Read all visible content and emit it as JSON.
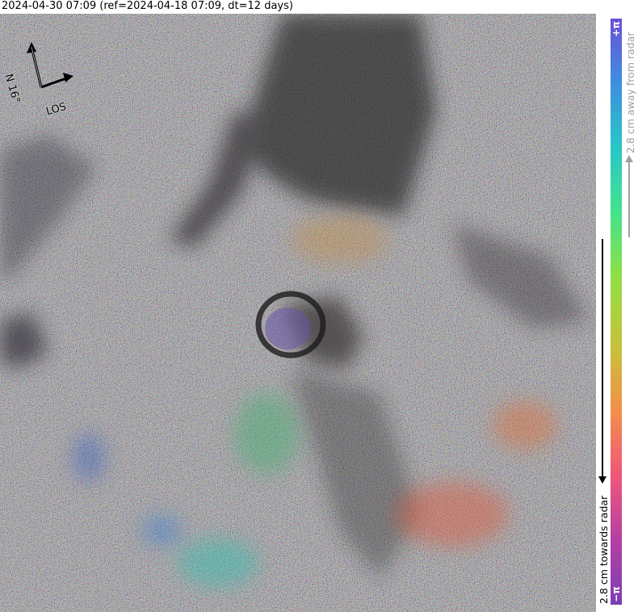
{
  "title": "2024-04-30 07:09 (ref=2024-04-18 07:09, dt=12 days)",
  "compass": {
    "north_label": "N 16°",
    "los_label": "LOS",
    "north_icon": "north-arrow-icon",
    "los_icon": "los-arrow-icon"
  },
  "colorbar": {
    "top_label": "+π",
    "bottom_label": "−π",
    "away_label": "2.8 cm away from radar",
    "toward_label": "2.8 cm towards radar",
    "colors": [
      "#7a3fb4",
      "#b53fa4",
      "#f0567a",
      "#f38f4a",
      "#c7c23a",
      "#8ee044",
      "#43e38e",
      "#27c7c7",
      "#3f8fe0",
      "#6a4fd6"
    ]
  }
}
